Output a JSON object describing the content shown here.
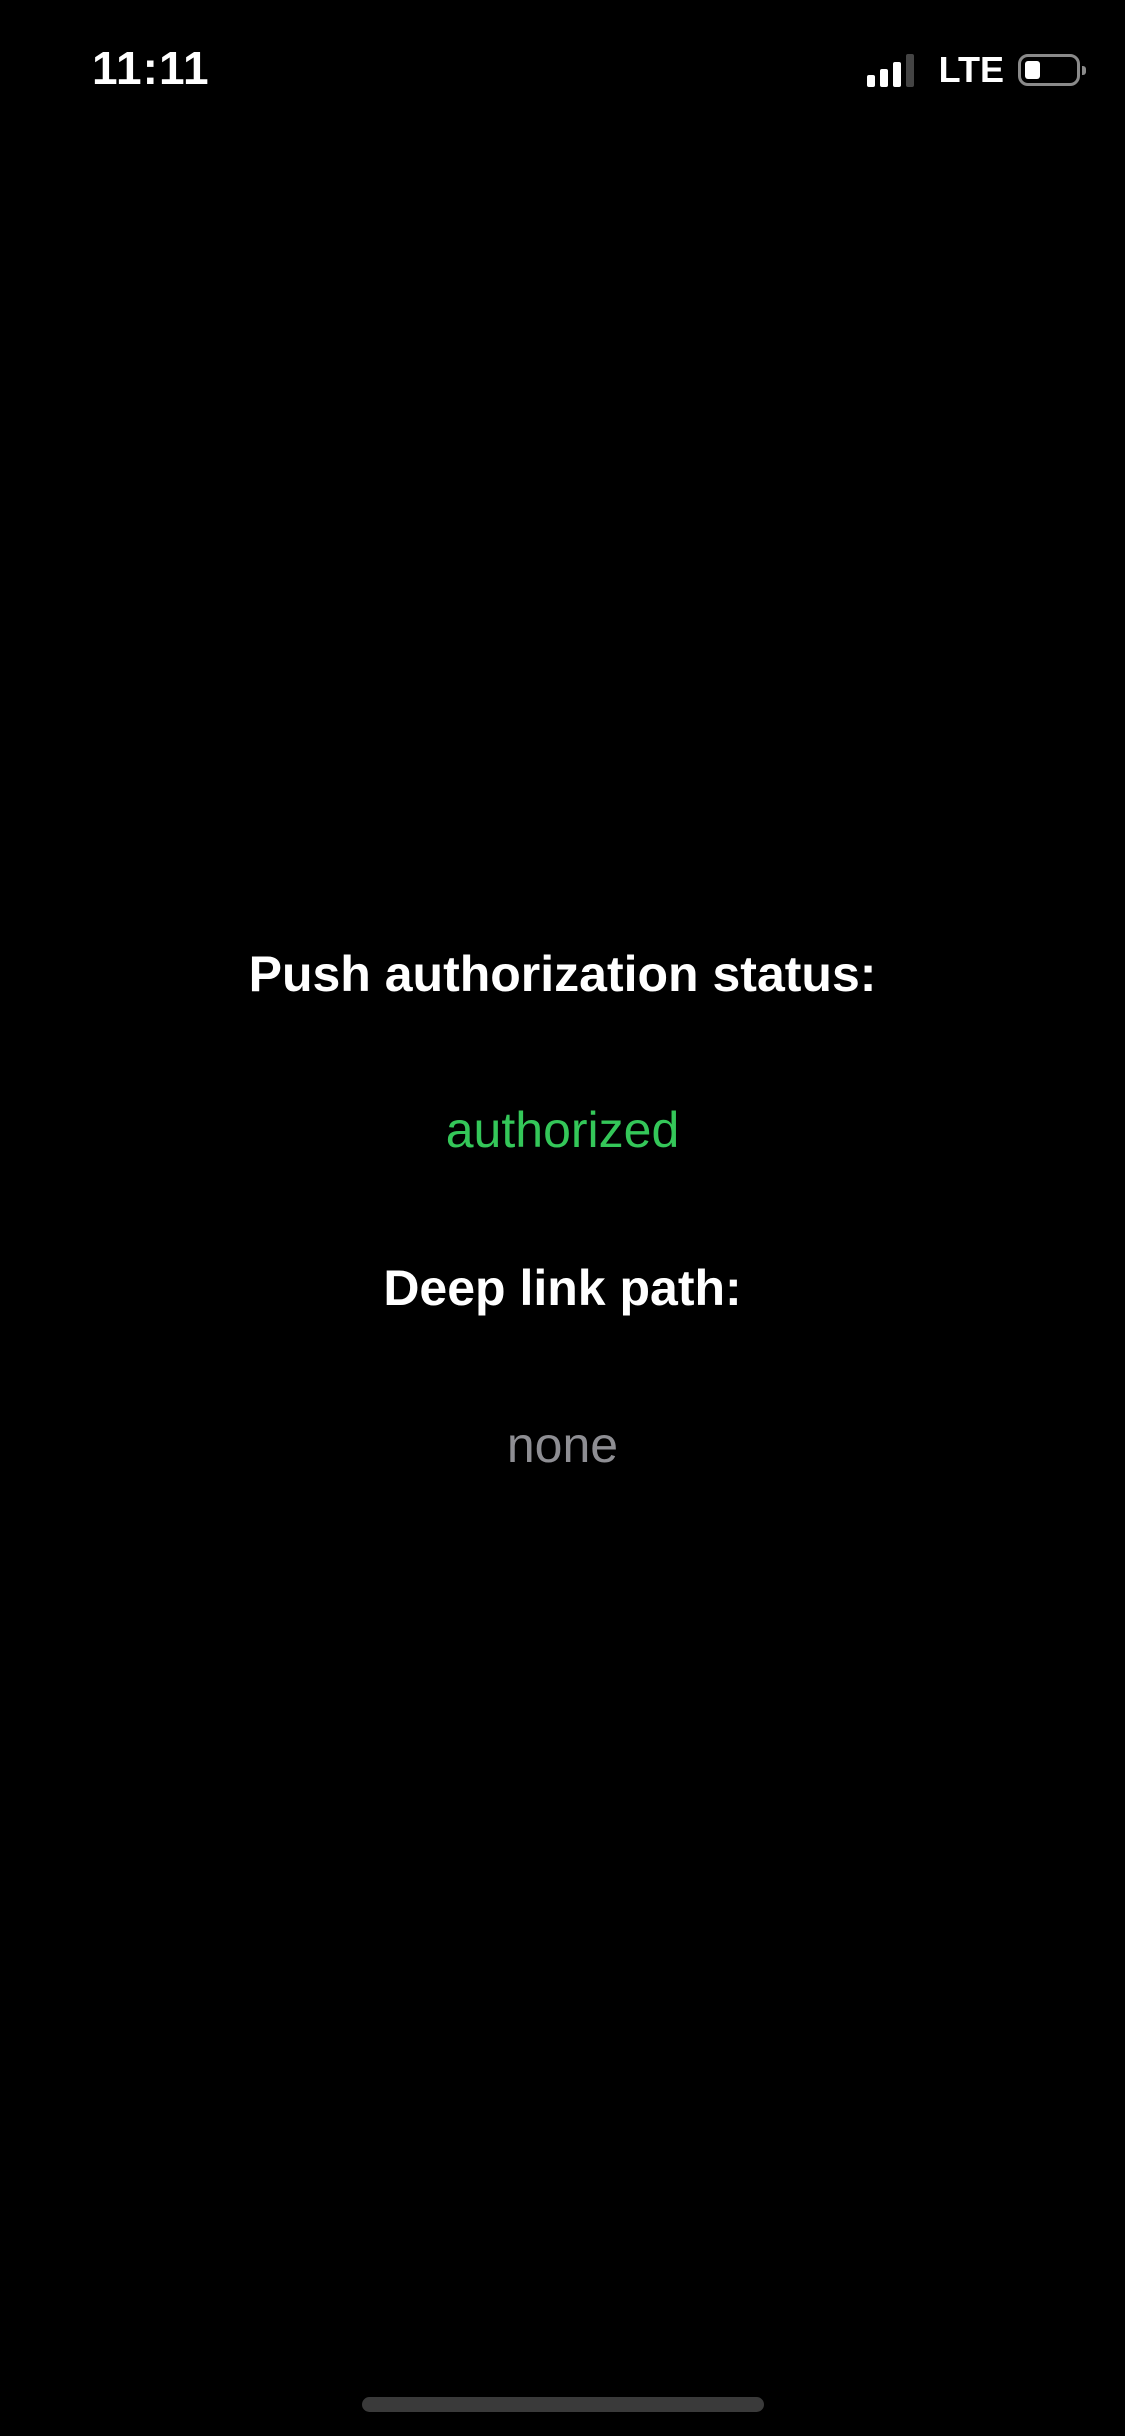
{
  "status_bar": {
    "time": "11:11",
    "network": "LTE",
    "signal_bars_active": 3,
    "signal_bars_total": 4,
    "battery_level": 0.2,
    "icons": [
      "signal-icon",
      "battery-icon"
    ]
  },
  "push_section": {
    "heading": "Push authorization status:",
    "value": "authorized",
    "value_color": "#34C759"
  },
  "deep_link_section": {
    "heading": "Deep link path:",
    "value": "none",
    "value_color": "#8E8E93"
  }
}
